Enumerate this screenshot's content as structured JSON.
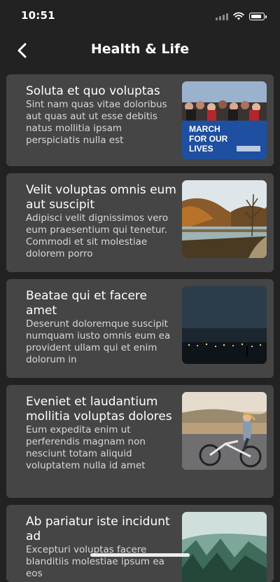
{
  "status": {
    "time": "10:51"
  },
  "nav": {
    "title": "Health & Life"
  },
  "articles": [
    {
      "title": "Soluta et quo voluptas",
      "body": "Sint nam quas vitae doloribus aut quas aut ut esse debitis natus mollitia ipsam perspiciatis nulla est",
      "image": "protest-march-photo",
      "image_text": [
        "MARCH",
        "FOR OUR",
        "LIVES"
      ]
    },
    {
      "title": "Velit voluptas omnis eum aut suscipit",
      "body": "Adipisci velit dignissimos vero eum praesentium qui tenetur. Commodi et sit molestiae dolorem porro",
      "image": "autumn-lake-photo"
    },
    {
      "title": "Beatae qui et facere amet",
      "body": "Deserunt doloremque suscipit numquam iusto omnis eum ea provident ullam qui et enim dolorum in",
      "image": "night-city-lights-photo"
    },
    {
      "title": "Eveniet et laudantium mollitia voluptas dolores",
      "body": "Eum expedita enim ut perferendis magnam non nesciunt totam aliquid voluptatem nulla id amet",
      "image": "woman-on-bicycle-photo"
    },
    {
      "title": "Ab pariatur iste incidunt ad",
      "body": "Excepturi voluptas facere blanditiis molestiae ipsum ea eos",
      "image": "mountain-forest-photo"
    }
  ]
}
